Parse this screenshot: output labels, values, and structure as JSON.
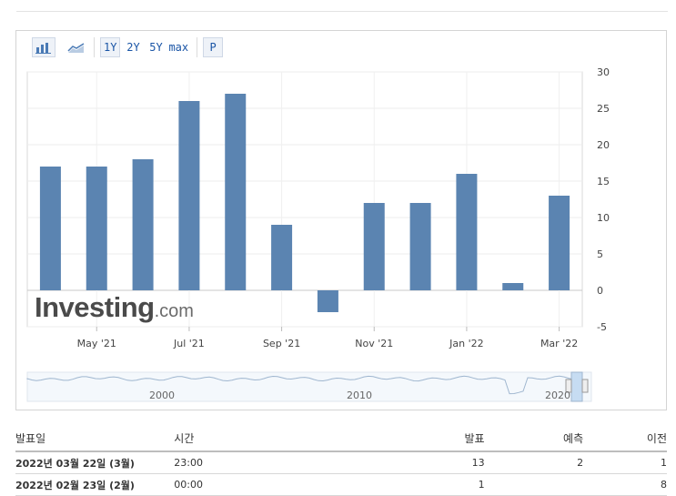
{
  "toolbar": {
    "bar_chart_icon": "bar-chart-icon",
    "line_chart_icon": "line-chart-icon",
    "ranges": [
      "1Y",
      "2Y",
      "5Y",
      "max"
    ],
    "selected_range": "1Y",
    "p_label": "P"
  },
  "logo": {
    "main": "Investing",
    "suffix": ".com"
  },
  "chart_data": {
    "type": "bar",
    "categories": [
      "2021-04",
      "2021-05",
      "2021-06",
      "2021-07",
      "2021-08",
      "2021-09",
      "2021-10",
      "2021-11",
      "2021-12",
      "2022-01",
      "2022-02",
      "2022-03"
    ],
    "values": [
      17,
      17,
      18,
      26,
      27,
      9,
      -3,
      12,
      12,
      16,
      1,
      13
    ],
    "x_tick_labels": [
      "May '21",
      "Jul '21",
      "Sep '21",
      "Nov '21",
      "Jan '22",
      "Mar '22"
    ],
    "y_ticks": [
      -5,
      0,
      5,
      10,
      15,
      20,
      25,
      30
    ],
    "ylim": [
      -5,
      30
    ],
    "navigator_labels": [
      "2000",
      "2010",
      "2020"
    ],
    "bar_color": "#5b84b1",
    "grid": true
  },
  "table": {
    "headers": {
      "date": "발표일",
      "time": "시간",
      "actual": "발표",
      "forecast": "예측",
      "previous": "이전"
    },
    "rows": [
      {
        "date": "2022년 03월 22일 (3월)",
        "time": "23:00",
        "actual": "13",
        "forecast": "2",
        "previous": "1"
      },
      {
        "date": "2022년 02월 23일 (2월)",
        "time": "00:00",
        "actual": "1",
        "forecast": "",
        "previous": "8"
      }
    ]
  }
}
